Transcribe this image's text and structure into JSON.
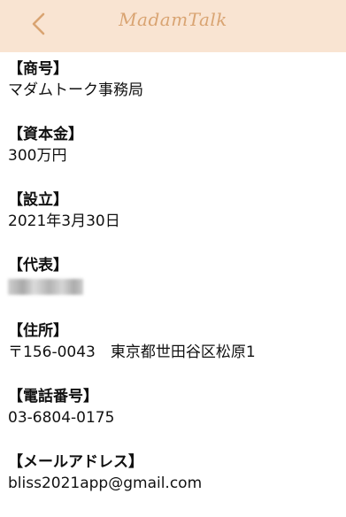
{
  "header": {
    "back_icon": "chevron-left-icon",
    "logo_text": "MadamTalk",
    "background_color": "#f9e4d2",
    "accent_color": "#d9a472"
  },
  "company": {
    "trade_name": {
      "heading": "【商号】",
      "value": "マダムトーク事務局"
    },
    "capital": {
      "heading": "【資本金】",
      "value": "300万円"
    },
    "established": {
      "heading": "【設立】",
      "value": "2021年3月30日"
    },
    "representative": {
      "heading": "【代表】"
    },
    "address": {
      "heading": "【住所】",
      "value": "〒156-0043　東京都世田谷区松原1"
    },
    "phone": {
      "heading": "【電話番号】",
      "value": "03-6804-0175"
    },
    "email": {
      "heading": "【メールアドレス】",
      "value": "bliss2021app@gmail.com"
    }
  }
}
